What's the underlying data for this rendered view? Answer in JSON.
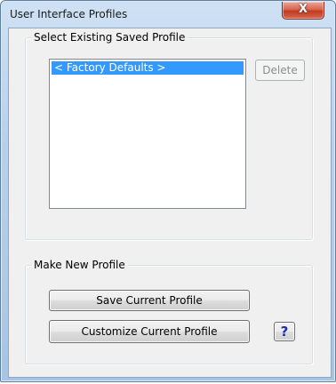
{
  "window": {
    "title": "User Interface Profiles",
    "close_symbol": "X"
  },
  "existing_group": {
    "label": "Select Existing Saved Profile",
    "profiles": [
      {
        "label": "< Factory Defaults >",
        "selected": true
      }
    ],
    "delete_label": "Delete"
  },
  "new_group": {
    "label": "Make New Profile",
    "save_label": "Save Current Profile",
    "customize_label": "Customize Current Profile",
    "help_symbol": "?"
  },
  "icons": {
    "close": "close-icon",
    "help": "question-icon"
  },
  "colors": {
    "selection": "#3399ff",
    "close_button": "#c23a22",
    "help_glyph": "#1c2fae"
  }
}
